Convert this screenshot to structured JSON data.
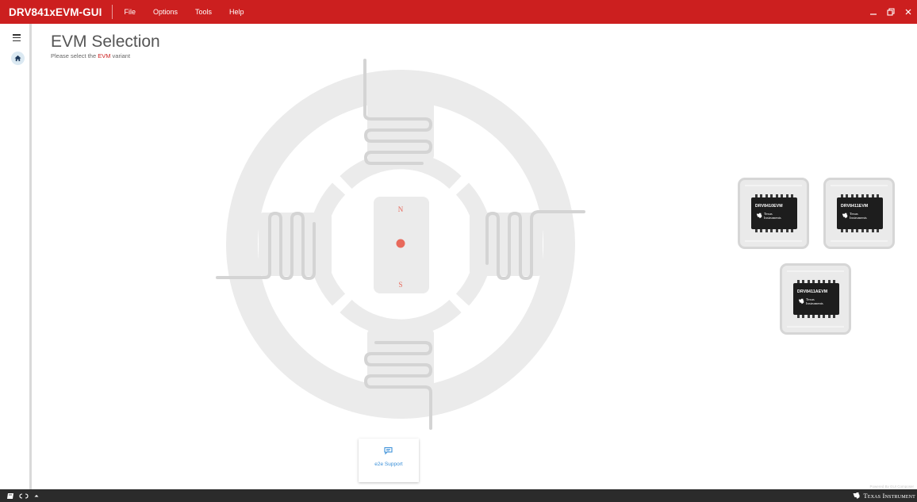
{
  "app": {
    "title": "DRV841xEVM-GUI",
    "menu": [
      "File",
      "Options",
      "Tools",
      "Help"
    ]
  },
  "colors": {
    "brand_red": "#cc1f1f",
    "motor_gray": "#ebebeb",
    "accent_red": "#e8695b",
    "link_blue": "#3a8fd8",
    "statusbar": "#2b2b2b"
  },
  "window_controls": [
    "minimize-icon",
    "restore-icon",
    "close-icon"
  ],
  "nav": {
    "icons": [
      "menu-icon",
      "home-icon"
    ]
  },
  "page": {
    "title": "EVM Selection",
    "subtitle_prefix": "Please select the ",
    "subtitle_accent": "EVM",
    "subtitle_suffix": " variant"
  },
  "motor": {
    "north": "N",
    "south": "S"
  },
  "evms": [
    {
      "name": "DRV8410EVM",
      "brand_line1": "Texas",
      "brand_line2": "Instruments"
    },
    {
      "name": "DRV8411EVM",
      "brand_line1": "Texas",
      "brand_line2": "Instruments"
    },
    {
      "name": "DRV8411AEVM",
      "brand_line1": "Texas",
      "brand_line2": "Instruments"
    }
  ],
  "support": {
    "label": "e2e Support",
    "icon": "chat-icon"
  },
  "footer": {
    "powered_by": "Powered By GUI Composer",
    "brand": "Texas Instrument",
    "status_icons": [
      "book-icon",
      "connection-icon",
      "chevron-up-icon"
    ]
  }
}
